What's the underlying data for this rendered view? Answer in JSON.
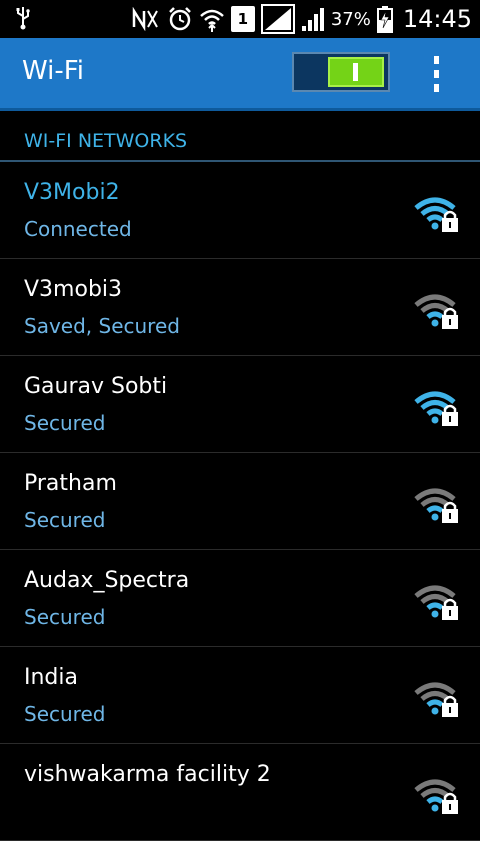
{
  "status_bar": {
    "battery_percent": "37%",
    "time": "14:45",
    "sim_slot": "1"
  },
  "header": {
    "title": "Wi-Fi",
    "wifi_enabled": true
  },
  "section": {
    "title": "WI-FI NETWORKS"
  },
  "networks": [
    {
      "name": "V3Mobi2",
      "status": "Connected",
      "signal": "strong",
      "connected": true
    },
    {
      "name": "V3mobi3",
      "status": "Saved, Secured",
      "signal": "weak",
      "connected": false
    },
    {
      "name": "Gaurav Sobti",
      "status": "Secured",
      "signal": "strong",
      "connected": false
    },
    {
      "name": "Pratham",
      "status": "Secured",
      "signal": "weak",
      "connected": false
    },
    {
      "name": "Audax_Spectra",
      "status": "Secured",
      "signal": "weak",
      "connected": false
    },
    {
      "name": "India",
      "status": "Secured",
      "signal": "weak",
      "connected": false
    },
    {
      "name": "vishwakarma facility 2",
      "status": "",
      "signal": "weak",
      "connected": false
    }
  ],
  "colors": {
    "accent": "#3fb3e8",
    "action_bar": "#1e78c8",
    "toggle_on": "#74d317"
  }
}
